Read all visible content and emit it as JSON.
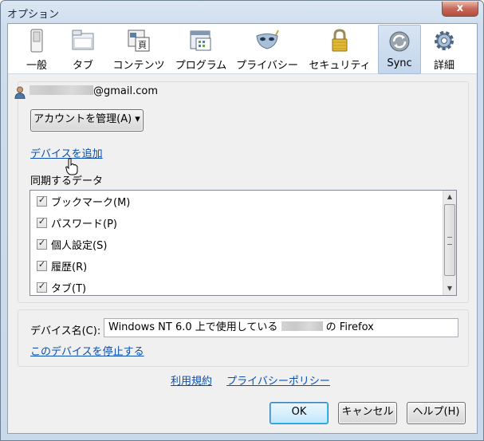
{
  "window": {
    "title": "オプション",
    "close_glyph": "x"
  },
  "toolbar": {
    "tabs": [
      {
        "label": "一般",
        "icon": "switch-icon"
      },
      {
        "label": "タブ",
        "icon": "tab-folder-icon"
      },
      {
        "label": "コンテンツ",
        "icon": "content-page-icon"
      },
      {
        "label": "プログラム",
        "icon": "program-window-icon"
      },
      {
        "label": "プライバシー",
        "icon": "mask-icon"
      },
      {
        "label": "セキュリティ",
        "icon": "padlock-icon"
      },
      {
        "label": "Sync",
        "icon": "sync-icon",
        "selected": true
      },
      {
        "label": "詳細",
        "icon": "gear-icon"
      }
    ]
  },
  "account": {
    "email_suffix": "@gmail.com"
  },
  "manage_button": {
    "label": "アカウントを管理(A) ▾"
  },
  "add_device_link": "デバイスを追加",
  "sync_section_label": "同期するデータ",
  "sync_items": [
    {
      "label": "ブックマーク(M)",
      "checked": true
    },
    {
      "label": "パスワード(P)",
      "checked": true
    },
    {
      "label": "個人設定(S)",
      "checked": true
    },
    {
      "label": "履歴(R)",
      "checked": true
    },
    {
      "label": "タブ(T)",
      "checked": true
    }
  ],
  "device": {
    "label": "デバイス名(C):",
    "value_prefix": "Windows NT 6.0 上で使用している",
    "value_suffix": "の Firefox",
    "stop_link": "このデバイスを停止する"
  },
  "footer_links": {
    "terms": "利用規約",
    "privacy": "プライバシーポリシー"
  },
  "buttons": {
    "ok": "OK",
    "cancel": "キャンセル",
    "help": "ヘルプ(H)"
  },
  "colors": {
    "link": "#0a4fb0",
    "selected_tab": "#c3d6ec"
  }
}
